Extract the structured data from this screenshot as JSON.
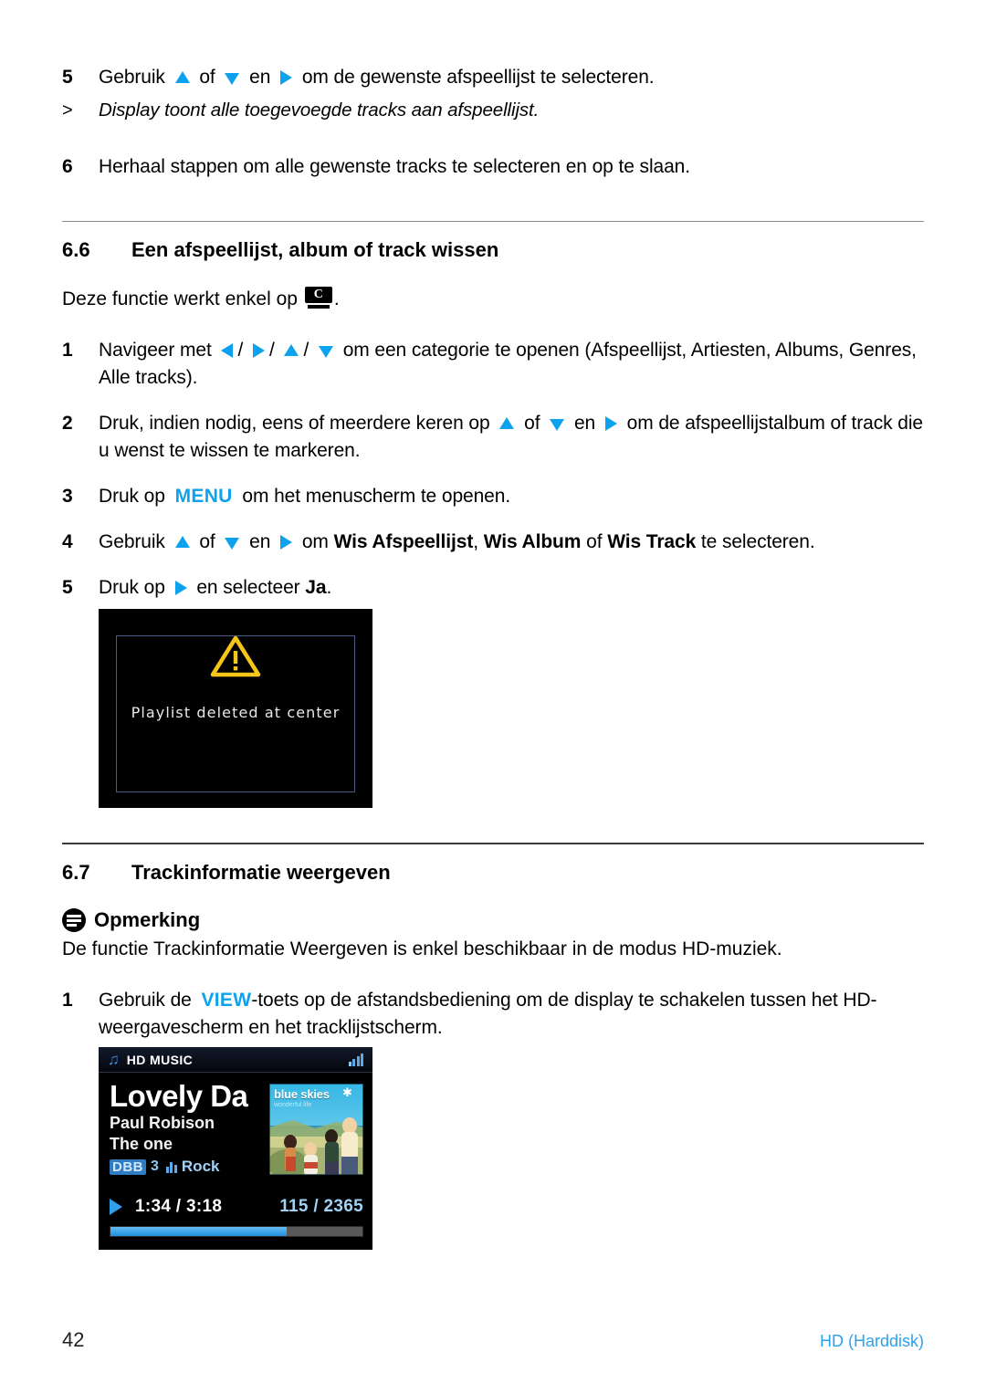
{
  "page": {
    "number": "42",
    "doc_ref": "HD (Harddisk)"
  },
  "steps_top": [
    {
      "num": "5",
      "parts": [
        "Gebruik ",
        "▲",
        " of ",
        "▼",
        " en ",
        "▶",
        " om de gewenste afspeellijst te selecteren."
      ],
      "text": "Gebruik ▲ of ▼ en ▶ om de gewenste afspeellijst te selecteren.",
      "pre": "Gebruik",
      "mid1": "of",
      "mid2": "en",
      "post": "om de gewenste afspeellijst te selecteren."
    }
  ],
  "result_line": {
    "marker": ">",
    "text": "Display toont alle toegevoegde tracks aan afspeellijst."
  },
  "step6": {
    "num": "6",
    "text": "Herhaal stappen om alle gewenste tracks te selecteren en op te slaan."
  },
  "section_66": {
    "number": "6.6",
    "title": "Een afspeellijst, album of track wissen",
    "intro_pre": "Deze functie werkt enkel op",
    "intro_badge": "C",
    "intro_post": ".",
    "steps": {
      "s1": {
        "num": "1",
        "pre": "Navigeer met",
        "post": "om een categorie te openen (Afspeellijst, Artiesten, Albums, Genres, Alle tracks)."
      },
      "s2": {
        "num": "2",
        "pre": "Druk, indien nodig, eens of meerdere keren op",
        "mid1": "of",
        "mid2": "en",
        "post": "om de afspeellijstalbum of track die u wenst te wissen te markeren."
      },
      "s3": {
        "num": "3",
        "pre": "Druk op",
        "key": "MENU",
        "post": "om het menuscherm te openen."
      },
      "s4": {
        "num": "4",
        "pre": "Gebruik",
        "mid1": "of",
        "mid2": "en",
        "mid3": "om",
        "bold1": "Wis Afspeellijst",
        "sep1": ",",
        "bold2": "Wis Album",
        "sep2": "of",
        "bold3": "Wis Track",
        "post": "te selecteren."
      },
      "s5": {
        "num": "5",
        "pre": "Druk op",
        "mid": "en selecteer",
        "bold": "Ja",
        "post": "."
      }
    }
  },
  "dialog_screenshot": {
    "icon": "warning-triangle-icon",
    "message": "Playlist deleted at center"
  },
  "section_67": {
    "number": "6.7",
    "title": "Trackinformatie weergeven",
    "note": {
      "icon": "note-icon",
      "heading": "Opmerking",
      "text": "De functie Trackinformatie Weergeven is enkel beschikbaar in de modus HD-muziek."
    },
    "step1": {
      "num": "1",
      "pre": "Gebruik de",
      "key": "VIEW",
      "post": "-toets op de afstandsbediening om de display te schakelen tussen het HD-weergavescherm en het tracklijstscherm."
    }
  },
  "player_screenshot": {
    "mode_label": "HD MUSIC",
    "signal_icon": "signal-strength-icon",
    "music_icon": "music-note-icon",
    "track_title": "Lovely Da",
    "artist": "Paul Robison",
    "album": "The one",
    "dbb_label": "DBB",
    "dbb_level": "3",
    "eq_icon": "equalizer-icon",
    "genre": "Rock",
    "play_icon": "play-icon",
    "time": "1:34 / 3:18",
    "track_count": "115 / 2365",
    "progress_percent": 70,
    "cover": {
      "title": "blue skies",
      "subtitle": "wonderful life",
      "star": "✱"
    }
  },
  "colors": {
    "accent_blue": "#0CA2EE",
    "doc_ref_blue": "#2aa3ef",
    "warning_yellow": "#F5C518",
    "screen_black": "#000000"
  }
}
